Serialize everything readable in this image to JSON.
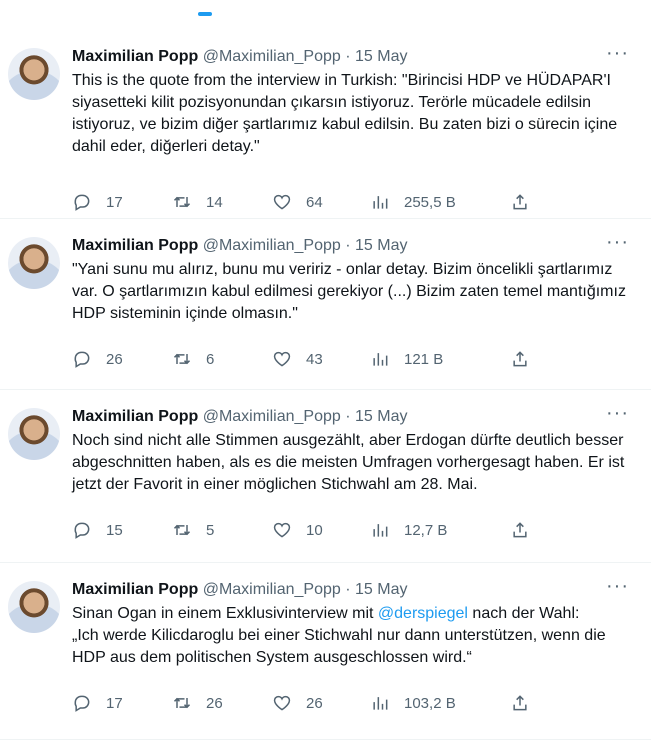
{
  "tweets": [
    {
      "name": "Maximilian Popp",
      "handle": "@Maximilian_Popp",
      "separator": "·",
      "date": "15 May",
      "more": "···",
      "text": "This is the quote from the interview in Turkish: \"Birincisi HDP ve HÜDAPAR'I siyasetteki kilit pozisyonundan çıkarsın istiyoruz. Terörle mücadele edilsin istiyoruz, ve bizim diğer şartlarımız kabul edilsin. Bu zaten bizi o sürecin içine dahil eder, diğerleri detay.\"",
      "replies": "17",
      "retweets": "14",
      "likes": "64",
      "views": "255,5 B"
    },
    {
      "name": "Maximilian Popp",
      "handle": "@Maximilian_Popp",
      "separator": "·",
      "date": "15 May",
      "more": "···",
      "text": "\"Yani sunu mu alırız, bunu mu veririz - onlar detay. Bizim öncelikli şartlarımız var. O şartlarımızın kabul edilmesi gerekiyor (...) Bizim zaten temel mantığımız HDP sisteminin içinde olmasın.\"",
      "replies": "26",
      "retweets": "6",
      "likes": "43",
      "views": "121 B"
    },
    {
      "name": "Maximilian Popp",
      "handle": "@Maximilian_Popp",
      "separator": "·",
      "date": "15 May",
      "more": "···",
      "text": "Noch sind nicht alle Stimmen ausgezählt, aber Erdogan dürfte deutlich besser abgeschnitten haben, als es die meisten Umfragen vorhergesagt haben. Er ist jetzt der Favorit in einer möglichen Stichwahl am 28. Mai.",
      "replies": "15",
      "retweets": "5",
      "likes": "10",
      "views": "12,7 B"
    },
    {
      "name": "Maximilian Popp",
      "handle": "@Maximilian_Popp",
      "separator": "·",
      "date": "15 May",
      "more": "···",
      "text_before": "Sinan Ogan in einem Exklusivinterview mit ",
      "mention": "@derspiegel",
      "text_after": " nach der Wahl:\n„Ich werde Kilicdaroglu bei einer Stichwahl nur dann unterstützen, wenn die HDP aus dem politischen System ausgeschlossen wird.“",
      "replies": "17",
      "retweets": "26",
      "likes": "26",
      "views": "103,2 B"
    }
  ]
}
